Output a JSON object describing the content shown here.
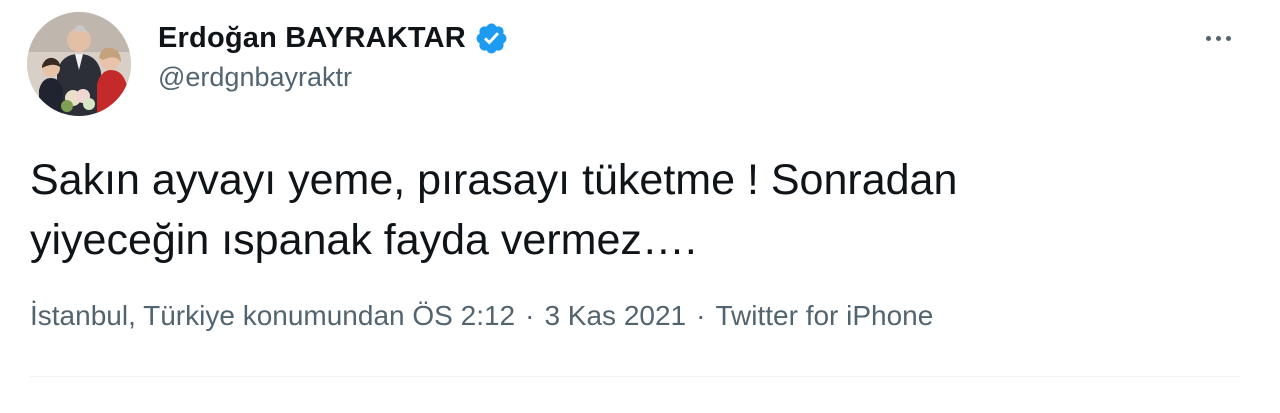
{
  "tweet": {
    "author": {
      "display_name": "Erdoğan BAYRAKTAR",
      "handle": "@erdgnbayraktr",
      "verified": true,
      "avatar_icon": "profile-photo"
    },
    "more_icon": "more-horizontal-icon",
    "text": "Sakın ayvayı yeme, pırasayı tüketme ! Sonradan\nyiyeceğin ıspanak fayda vermez….",
    "meta": {
      "location": "İstanbul, Türkiye konumundan",
      "time": "ÖS 2:12",
      "separator": "·",
      "date": "3 Kas 2021",
      "source": "Twitter for iPhone"
    },
    "colors": {
      "text": "#0f1419",
      "secondary": "#536471",
      "verified": "#1d9bf0",
      "divider": "#eff3f4"
    }
  }
}
